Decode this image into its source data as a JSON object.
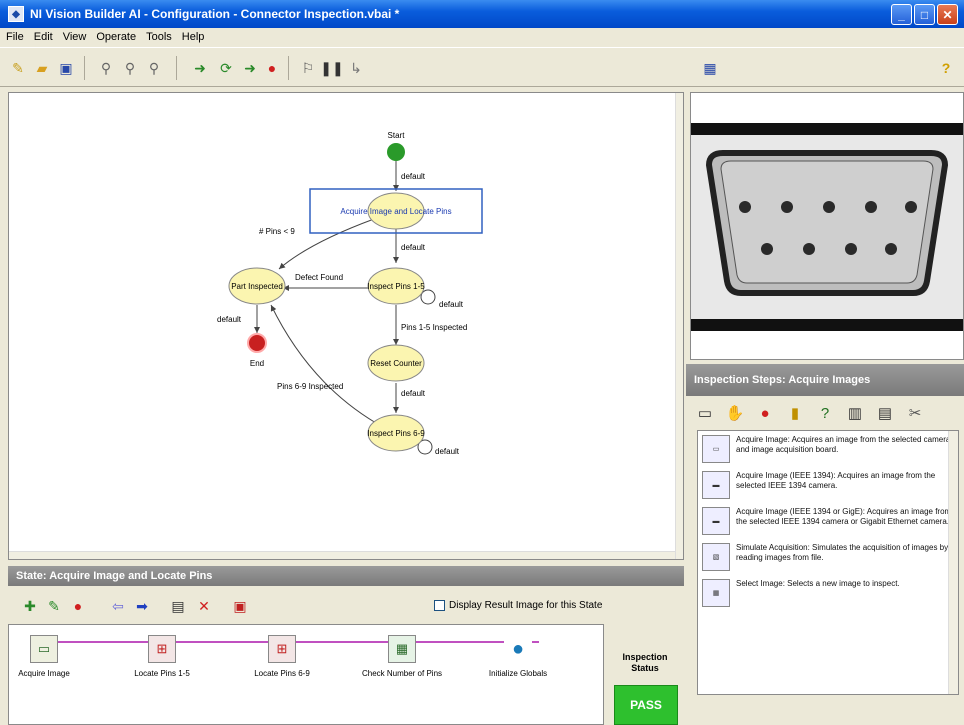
{
  "window": {
    "title": "NI Vision Builder AI - Configuration - Connector Inspection.vbai *"
  },
  "menu": [
    "File",
    "Edit",
    "View",
    "Operate",
    "Tools",
    "Help"
  ],
  "diagram": {
    "states": {
      "start": "Start",
      "acquire": "Acquire Image and Locate Pins",
      "inspect_pins_1_5": "Inspect Pins 1-5",
      "part_inspected": "Part Inspected",
      "reset_counter": "Reset Counter",
      "inspect_pins_6_9": "Inspect Pins 6-9",
      "end": "End"
    },
    "transitions": {
      "start_default": "default",
      "acquire_default": "default",
      "if_pins_lt_9": "# Pins < 9",
      "defect_found": "Defect Found",
      "pins15_default": "default",
      "pins_1_5_inspected": "Pins 1-5 Inspected",
      "part_default": "default",
      "pins_6_9_inspected": "Pins 6-9 Inspected",
      "reset_default": "default",
      "pins69_default": "default"
    }
  },
  "steps_panel": {
    "title": "Inspection Steps: Acquire Images",
    "items": [
      {
        "icon": "camera",
        "text": "Acquire Image: Acquires an image from the selected camera and image acquisition board."
      },
      {
        "icon": "1394",
        "text": "Acquire Image (IEEE 1394): Acquires an image from the selected IEEE 1394 camera."
      },
      {
        "icon": "GigE",
        "text": "Acquire Image (IEEE 1394 or GigE): Acquires an image from the selected IEEE 1394 camera or Gigabit Ethernet camera."
      },
      {
        "icon": "file",
        "text": "Simulate Acquisition: Simulates the acquisition of images by reading images from file."
      },
      {
        "icon": "select",
        "text": "Select Image: Selects a new image to inspect."
      }
    ]
  },
  "state_panel": {
    "header": "State: Acquire Image and Locate Pins",
    "checkbox_label": "Display Result Image for this State",
    "steps": [
      "Acquire Image",
      "Locate Pins 1-5",
      "Locate Pins 6-9",
      "Check Number of Pins",
      "Initialize Globals"
    ]
  },
  "inspection_status": {
    "label": "Inspection Status",
    "value": "PASS"
  }
}
